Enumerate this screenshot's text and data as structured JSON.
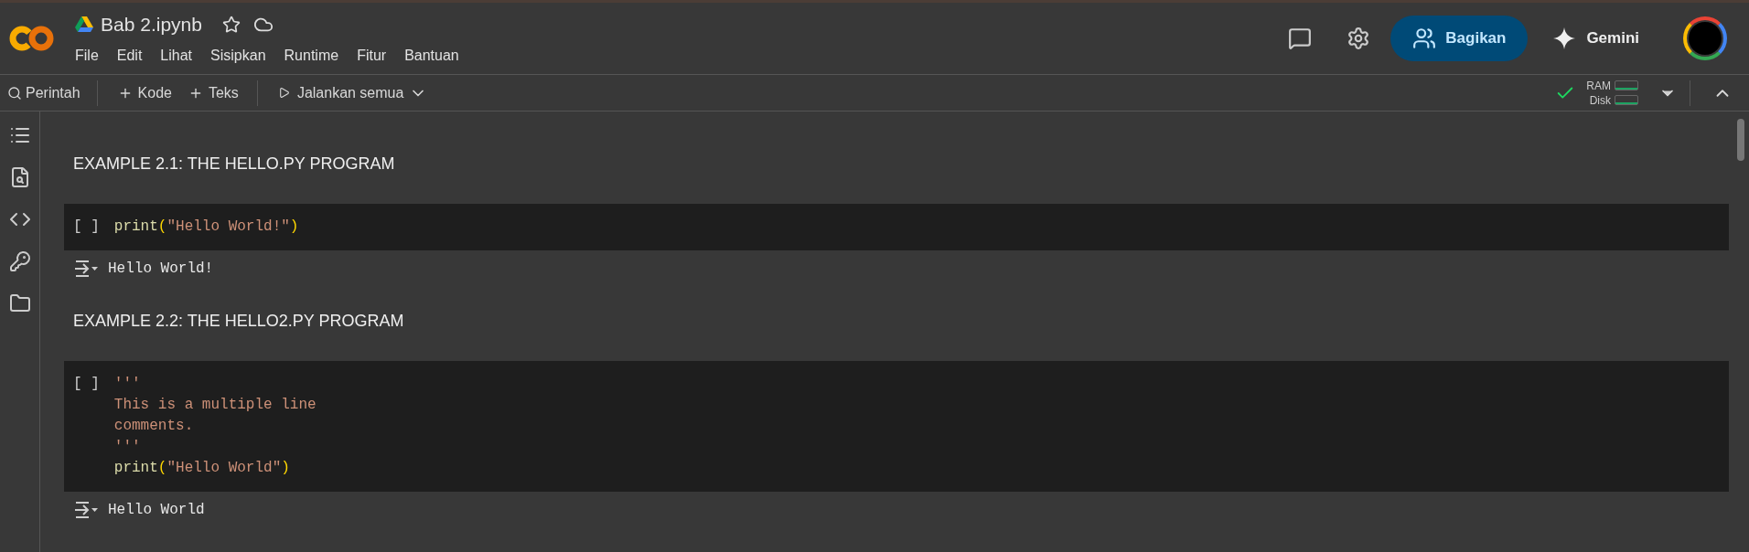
{
  "header": {
    "title": "Bab 2.ipynb",
    "menu": [
      "File",
      "Edit",
      "Lihat",
      "Sisipkan",
      "Runtime",
      "Fitur",
      "Bantuan"
    ],
    "share": "Bagikan",
    "gemini": "Gemini"
  },
  "toolbar": {
    "command": "Perintah",
    "add_code": "Kode",
    "add_text": "Teks",
    "run_all": "Jalankan semua",
    "ram": "RAM",
    "disk": "Disk"
  },
  "cells": [
    {
      "kind": "text",
      "heading": "EXAMPLE 2.1: THE HELLO.PY PROGRAM"
    },
    {
      "kind": "code",
      "prompt": "[ ]",
      "lines": [
        [
          {
            "t": "print",
            "kind": "function"
          },
          {
            "t": "(",
            "kind": "paren"
          },
          {
            "t": "\"Hello World!\"",
            "kind": "string"
          },
          {
            "t": ")",
            "kind": "paren"
          }
        ]
      ],
      "output": "Hello World!"
    },
    {
      "kind": "text",
      "heading": "EXAMPLE 2.2: THE HELLO2.PY PROGRAM"
    },
    {
      "kind": "code",
      "prompt": "[ ]",
      "lines": [
        [
          {
            "t": "'''",
            "kind": "string"
          }
        ],
        [
          {
            "t": "This is a multiple line",
            "kind": "string"
          }
        ],
        [
          {
            "t": "comments.",
            "kind": "string"
          }
        ],
        [
          {
            "t": "'''",
            "kind": "string"
          }
        ],
        [
          {
            "t": "print",
            "kind": "function"
          },
          {
            "t": "(",
            "kind": "paren"
          },
          {
            "t": "\"Hello World\"",
            "kind": "string"
          },
          {
            "t": ")",
            "kind": "paren"
          }
        ]
      ],
      "output": "Hello World"
    }
  ]
}
